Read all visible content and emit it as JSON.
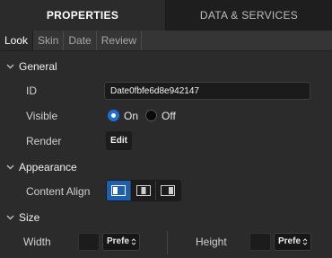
{
  "top_tabs": [
    {
      "label": "PROPERTIES",
      "active": true
    },
    {
      "label": "DATA & SERVICES",
      "active": false
    }
  ],
  "sub_tabs": [
    {
      "label": "Look",
      "active": true
    },
    {
      "label": "Skin",
      "active": false
    },
    {
      "label": "Date",
      "active": false
    },
    {
      "label": "Review",
      "active": false
    }
  ],
  "general": {
    "section_label": "General",
    "id_label": "ID",
    "id_value": "Date0fbfe6d8e942147",
    "visible_label": "Visible",
    "visible_on_label": "On",
    "visible_off_label": "Off",
    "visible_selected": "On",
    "render_label": "Render",
    "render_button": "Edit"
  },
  "appearance": {
    "section_label": "Appearance",
    "content_align_label": "Content Align",
    "align_options": [
      "align-left-icon",
      "align-center-icon",
      "align-right-icon"
    ],
    "align_selected": "left"
  },
  "size": {
    "section_label": "Size",
    "width_label": "Width",
    "width_unit": "Prefe",
    "height_label": "Height",
    "height_unit": "Prefe"
  },
  "colors": {
    "accent": "#1d6fd1",
    "background": "#2b2b2b"
  }
}
